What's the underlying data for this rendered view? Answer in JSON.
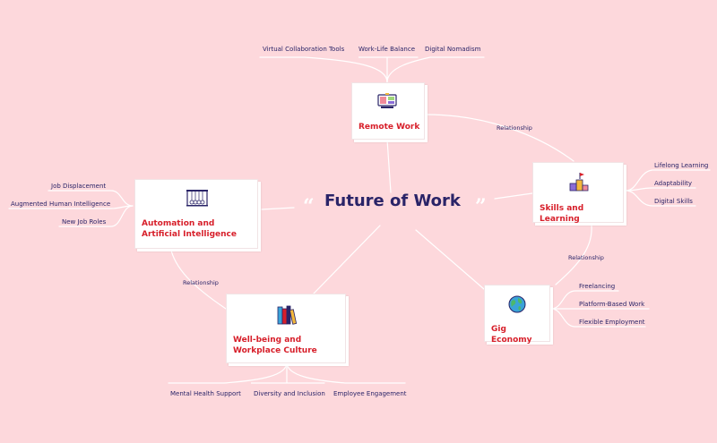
{
  "central": {
    "title": "Future of Work"
  },
  "topics": {
    "remote_work": {
      "label": "Remote Work",
      "icon": "monitor-icon",
      "children": [
        "Virtual Collaboration Tools",
        "Work-Life Balance",
        "Digital Nomadism"
      ]
    },
    "skills_learning": {
      "label": "Skills and Learning",
      "icon": "podium-icon",
      "children": [
        "Lifelong Learning",
        "Adaptability",
        "Digital Skills"
      ]
    },
    "gig_economy": {
      "label": "Gig Economy",
      "icon": "globe-icon",
      "children": [
        "Freelancing",
        "Platform-Based Work",
        "Flexible Employment"
      ]
    },
    "wellbeing": {
      "label": "Well-being and Workplace Culture",
      "icon": "books-icon",
      "children": [
        "Mental Health Support",
        "Diversity and Inclusion",
        "Employee Engagement"
      ]
    },
    "automation": {
      "label": "Automation and Artificial Intelligence",
      "icon": "newtons-cradle-icon",
      "children": [
        "Job Displacement",
        "Augmented Human Intelligence",
        "New Job Roles"
      ]
    }
  },
  "relationships": [
    "Relationship",
    "Relationship",
    "Relationship"
  ],
  "colors": {
    "background": "#fdd8dc",
    "title": "#2a2468",
    "topic_label": "#d71f2a",
    "connector": "#ffffff"
  }
}
